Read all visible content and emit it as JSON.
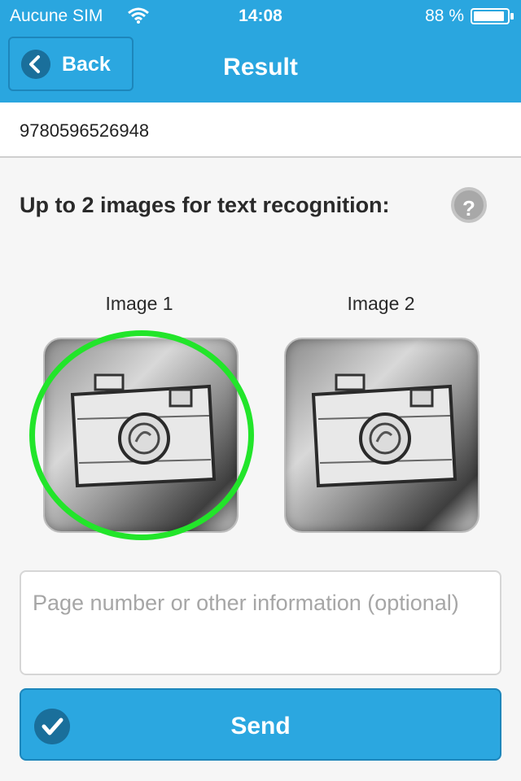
{
  "status_bar": {
    "carrier": "Aucune SIM",
    "time": "14:08",
    "battery": "88 %"
  },
  "nav": {
    "back_label": "Back",
    "title": "Result"
  },
  "isbn": "9780596526948",
  "section": {
    "heading": "Up to 2 images for text recognition:",
    "help_icon": "?"
  },
  "images": [
    {
      "label": "Image 1",
      "selected": true
    },
    {
      "label": "Image 2",
      "selected": false
    }
  ],
  "info_input": {
    "placeholder": "Page number or other information (optional)",
    "value": ""
  },
  "send_button": {
    "label": "Send"
  },
  "colors": {
    "accent": "#2aa6df",
    "selection_ring": "#22e52a",
    "background": "#f6f6f6"
  }
}
